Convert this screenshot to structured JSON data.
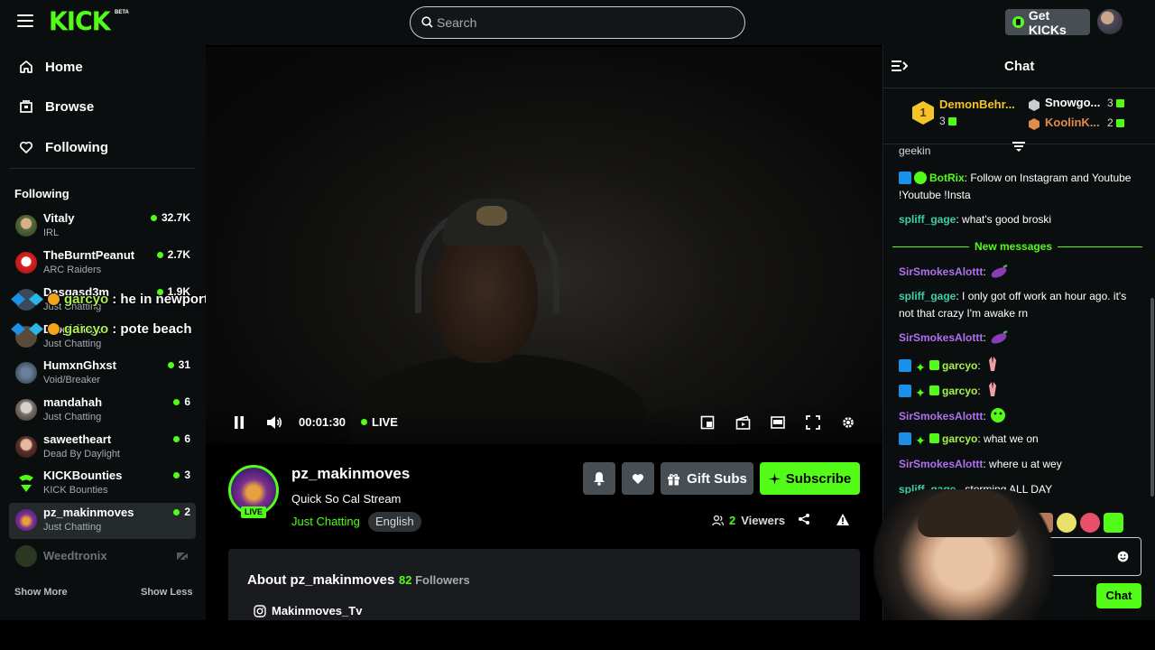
{
  "header": {
    "logo": "KICK",
    "beta": "BETA",
    "search_placeholder": "Search",
    "get_kicks_label": "Get KICKs"
  },
  "sidebar": {
    "nav": [
      {
        "label": "Home",
        "icon": "home-icon"
      },
      {
        "label": "Browse",
        "icon": "browse-icon"
      },
      {
        "label": "Following",
        "icon": "heart-icon"
      }
    ],
    "following_header": "Following",
    "channels": [
      {
        "name": "Vitaly",
        "category": "IRL",
        "viewers": "32.7K"
      },
      {
        "name": "TheBurntPeanut",
        "category": "ARC Raiders",
        "viewers": "2.7K"
      },
      {
        "name": "Dasgasd3m",
        "category": "Just Chatting",
        "viewers": "1.9K"
      },
      {
        "name": "Diogidiogo",
        "category": "Just Chatting",
        "viewers": ""
      },
      {
        "name": "HumxnGhxst",
        "category": "Void/Breaker",
        "viewers": "31"
      },
      {
        "name": "mandahah",
        "category": "Just Chatting",
        "viewers": "6"
      },
      {
        "name": "saweetheart",
        "category": "Dead By Daylight",
        "viewers": "6"
      },
      {
        "name": "KICKBounties",
        "category": "KICK Bounties",
        "viewers": "3"
      },
      {
        "name": "pz_makinmoves",
        "category": "Just Chatting",
        "viewers": "2"
      }
    ],
    "offline_channel": "Weedtronix",
    "show_more": "Show More",
    "show_less": "Show Less"
  },
  "overlay": [
    {
      "user": "garcyo",
      "text": ": he in newport"
    },
    {
      "user": "garcyo",
      "text": ": pote beach"
    }
  ],
  "player": {
    "time": "00:01:30",
    "live_label": "LIVE"
  },
  "channel": {
    "name": "pz_makinmoves",
    "live_tag": "LIVE",
    "stream_title": "Quick So Cal Stream",
    "category": "Just Chatting",
    "language": "English",
    "gift_subs_label": "Gift Subs",
    "subscribe_label": "Subscribe",
    "viewers_count": "2",
    "viewers_label": "Viewers",
    "about_title": "About pz_makinmoves",
    "followers_count": "82",
    "followers_label": "Followers",
    "instagram": "Makinmoves_Tv"
  },
  "chat": {
    "title": "Chat",
    "leaderboard": [
      {
        "rank": "1",
        "name": "DemonBehr...",
        "count": "3"
      },
      {
        "rank": "2",
        "name": "Snowgo...",
        "count": "3"
      },
      {
        "rank": "3",
        "name": "KoolinK...",
        "count": "2"
      }
    ],
    "partial_top": "geekin",
    "messages": [
      {
        "user": "BotRix",
        "text": ": Follow on Instagram and Youtube !Youtube !Insta",
        "color": "#53fc18"
      },
      {
        "user": "spliff_gage",
        "text": ": what's good broski",
        "color": "#3fcfa4"
      },
      {
        "user": "SirSmokesAlottt",
        "text": ":",
        "color": "#b070f0"
      },
      {
        "user": "spliff_gage",
        "text": ": I only got off work an hour ago. it's not that crazy I'm awake rn",
        "color": "#3fcfa4"
      },
      {
        "user": "SirSmokesAlottt",
        "text": ":",
        "color": "#b070f0"
      },
      {
        "user": "garcyo",
        "text": ":",
        "color": "#a6f14d"
      },
      {
        "user": "garcyo",
        "text": ":",
        "color": "#a6f14d"
      },
      {
        "user": "SirSmokesAlottt",
        "text": ":",
        "color": "#b070f0"
      },
      {
        "user": "garcyo",
        "text": ": what we on",
        "color": "#a6f14d"
      },
      {
        "user": "SirSmokesAlottt",
        "text": ": where u at wey",
        "color": "#b070f0"
      },
      {
        "user": "spliff_gage",
        "text": "...storming ALL DAY",
        "color": "#3fcfa4"
      }
    ],
    "new_messages_label": "New messages",
    "input_placeholder": "",
    "send_label": "Chat"
  },
  "colors": {
    "brand": "#53fc18",
    "background": "#0b0e0f",
    "button_gray": "#474f54"
  }
}
